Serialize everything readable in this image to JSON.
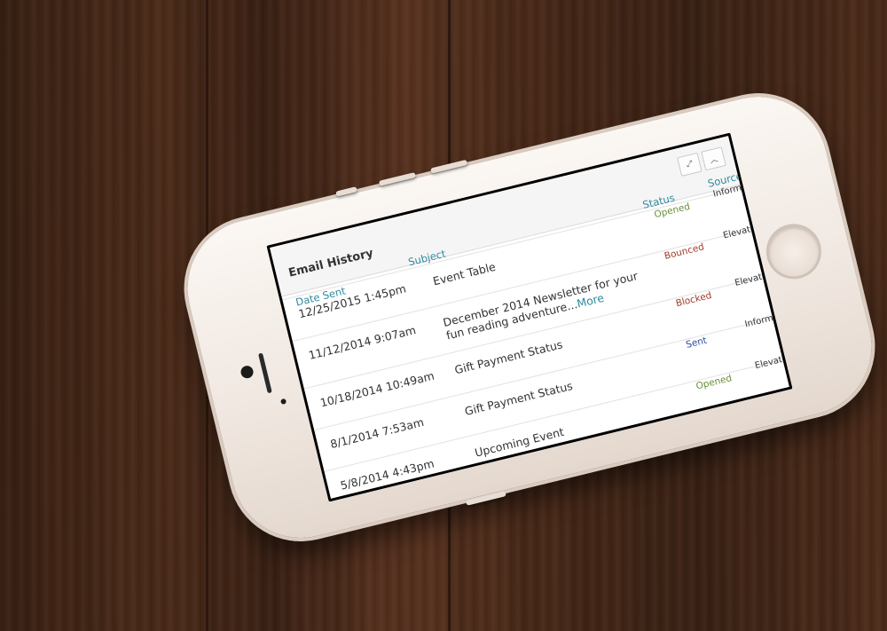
{
  "panel": {
    "title": "Email History",
    "expand_icon": "expand-icon",
    "collapse_icon": "chevron-up-icon"
  },
  "columns": {
    "date_sent": "Date Sent",
    "subject": "Subject",
    "status": "Status",
    "source": "Source"
  },
  "rows": [
    {
      "date": "12/25/2015 1:45pm",
      "subject": "Event Table",
      "more": "",
      "status": "Opened",
      "source": "Informz"
    },
    {
      "date": "11/12/2014 9:07am",
      "subject": "December 2014 Newsletter for your fun reading adventure...",
      "more": "More",
      "status": "Bounced",
      "source": "Elevate"
    },
    {
      "date": "10/18/2014 10:49am",
      "subject": "Gift Payment Status",
      "more": "",
      "status": "Blocked",
      "source": "Elevate"
    },
    {
      "date": "8/1/2014 7:53am",
      "subject": "Gift Payment Status",
      "more": "",
      "status": "Sent",
      "source": "Informz"
    },
    {
      "date": "5/8/2014 4:43pm",
      "subject": "Upcoming Event",
      "more": "",
      "status": "Opened",
      "source": "Elevate"
    }
  ],
  "status_colors": {
    "Opened": "#6a8f3a",
    "Bounced": "#a33a2a",
    "Blocked": "#a33a2a",
    "Sent": "#2a4f9b"
  }
}
